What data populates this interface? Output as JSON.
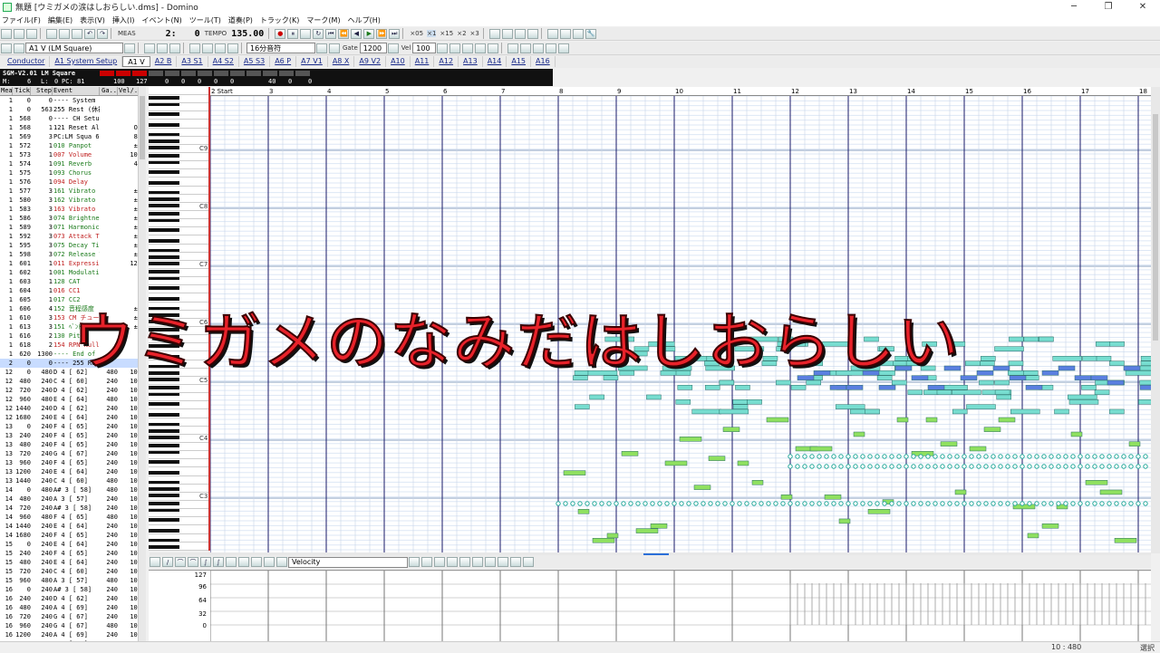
{
  "window": {
    "title": "無題 [ウミガメの涙はしおらしい.dms] - Domino"
  },
  "menu": [
    "ファイル(F)",
    "編集(E)",
    "表示(V)",
    "挿入(I)",
    "イベント(N)",
    "ツール(T)",
    "道奏(P)",
    "トラック(K)",
    "マーク(M)",
    "ヘルプ(H)"
  ],
  "toolbar": {
    "meas_label": "MEAS",
    "meas_value": "2:",
    "tick_value": "0",
    "tempo_label": "TEMPO",
    "tempo_value": "135.00",
    "speeds": [
      "×05",
      "×1",
      "×15",
      "×2",
      "×3"
    ]
  },
  "toolbar2": {
    "track_select": "A1 V (LM Square)",
    "note_length": "16分音符",
    "gate_label": "Gate",
    "gate_value": "1200",
    "vel_label": "Vel",
    "vel_value": "100"
  },
  "tabs": [
    "Conductor",
    "A1 System Setup",
    "A1 V",
    "A2 B",
    "A3 S1",
    "A4 S2",
    "A5 S3",
    "A6 P",
    "A7 V1",
    "A8 X",
    "A9 V2",
    "A10",
    "A11",
    "A12",
    "A13",
    "A14",
    "A15",
    "A16"
  ],
  "active_tab": "A1 V",
  "info": {
    "device": "SGM-V2.01 LM Square",
    "ch": "6",
    "l": "0",
    "pc": "81",
    "vals": [
      "100",
      "127",
      "0",
      "0",
      "0",
      "0",
      "0",
      "40",
      "0",
      "0"
    ]
  },
  "list": {
    "headers": [
      "Mea",
      "Tick",
      "Step",
      "Event",
      "Ga..",
      "Vel/.."
    ],
    "rows": [
      [
        "1",
        "0",
        "0",
        "---- System Setup ---",
        "",
        " "
      ],
      [
        "1",
        "0",
        "563",
        "255 Rest (休符)",
        "",
        ""
      ],
      [
        "1",
        "568",
        "0",
        "---- CH Setup ----",
        "",
        ""
      ],
      [
        "1",
        "568",
        "1",
        "121 Reset All C",
        "",
        "ON"
      ],
      [
        "1",
        "569",
        "3",
        "PC:LM Squa 6/0",
        "",
        "81"
      ],
      [
        "1",
        "572",
        "1",
        "010 Panpot",
        "",
        "±0"
      ],
      [
        "1",
        "573",
        "1",
        "007 Volume",
        "",
        "100"
      ],
      [
        "1",
        "574",
        "1",
        "091 Reverb",
        "",
        "40"
      ],
      [
        "1",
        "575",
        "1",
        "093 Chorus",
        "",
        "0"
      ],
      [
        "1",
        "576",
        "1",
        "094 Delay",
        "",
        "0"
      ],
      [
        "1",
        "577",
        "3",
        "161 Vibrato Rat",
        "",
        "±0"
      ],
      [
        "1",
        "580",
        "3",
        "162 Vibrato Dep",
        "",
        "±0"
      ],
      [
        "1",
        "583",
        "3",
        "163 Vibrato Del",
        "",
        "±0"
      ],
      [
        "1",
        "586",
        "3",
        "074 Brightness",
        "",
        "±0"
      ],
      [
        "1",
        "589",
        "3",
        "071 Harmonic Co",
        "",
        "±0"
      ],
      [
        "1",
        "592",
        "3",
        "073 Attack Time",
        "",
        "±0"
      ],
      [
        "1",
        "595",
        "3",
        "075 Decay Time",
        "",
        "±0"
      ],
      [
        "1",
        "598",
        "3",
        "072 Release Tin",
        "",
        "±0"
      ],
      [
        "1",
        "601",
        "1",
        "011 Expression",
        "",
        "127"
      ],
      [
        "1",
        "602",
        "1",
        "001 Modulation",
        "",
        "0"
      ],
      [
        "1",
        "603",
        "1",
        "128 CAT",
        "",
        "0"
      ],
      [
        "1",
        "604",
        "1",
        "016 CC1",
        "",
        "0"
      ],
      [
        "1",
        "605",
        "1",
        "017 CC2",
        "",
        "0"
      ],
      [
        "1",
        "606",
        "4",
        "152 音程感度",
        "",
        "±0"
      ],
      [
        "1",
        "610",
        "3",
        "153 CM チューン",
        "",
        "±0"
      ],
      [
        "1",
        "613",
        "3",
        "151 ﾍﾞﾝﾄﾞ幅",
        "",
        "±0"
      ],
      [
        "1",
        "616",
        "2",
        "130 Pitch",
        "",
        "0"
      ],
      [
        "1",
        "618",
        "2",
        "154 RPN Null",
        "",
        "0"
      ],
      [
        "1",
        "620",
        "1300",
        "---- End of CH Setup",
        "",
        ""
      ],
      [
        "2",
        "0",
        "0",
        "---- 255 Rest (休符)",
        "",
        ""
      ],
      [
        "12",
        "0",
        "480",
        "D  4 [ 62]",
        "480",
        "100"
      ],
      [
        "12",
        "480",
        "240",
        "C  4 [ 60]",
        "240",
        "100"
      ],
      [
        "12",
        "720",
        "240",
        "D  4 [ 62]",
        "240",
        "100"
      ],
      [
        "12",
        "960",
        "480",
        "E  4 [ 64]",
        "480",
        "100"
      ],
      [
        "12",
        "1440",
        "240",
        "D  4 [ 62]",
        "240",
        "100"
      ],
      [
        "12",
        "1680",
        "240",
        "E  4 [ 64]",
        "240",
        "100"
      ],
      [
        "13",
        "0",
        "240",
        "F  4 [ 65]",
        "240",
        "100"
      ],
      [
        "13",
        "240",
        "240",
        "F  4 [ 65]",
        "240",
        "100"
      ],
      [
        "13",
        "480",
        "240",
        "F  4 [ 65]",
        "240",
        "100"
      ],
      [
        "13",
        "720",
        "240",
        "G  4 [ 67]",
        "240",
        "100"
      ],
      [
        "13",
        "960",
        "240",
        "F  4 [ 65]",
        "240",
        "100"
      ],
      [
        "13",
        "1200",
        "240",
        "E  4 [ 64]",
        "240",
        "100"
      ],
      [
        "13",
        "1440",
        "240",
        "C  4 [ 60]",
        "480",
        "100"
      ],
      [
        "14",
        "0",
        "480",
        "A# 3 [ 58]",
        "480",
        "100"
      ],
      [
        "14",
        "480",
        "240",
        "A  3 [ 57]",
        "240",
        "100"
      ],
      [
        "14",
        "720",
        "240",
        "A# 3 [ 58]",
        "240",
        "100"
      ],
      [
        "14",
        "960",
        "480",
        "F  4 [ 65]",
        "480",
        "100"
      ],
      [
        "14",
        "1440",
        "240",
        "E  4 [ 64]",
        "240",
        "100"
      ],
      [
        "14",
        "1680",
        "240",
        "F  4 [ 65]",
        "240",
        "100"
      ],
      [
        "15",
        "0",
        "240",
        "E  4 [ 64]",
        "240",
        "100"
      ],
      [
        "15",
        "240",
        "240",
        "F  4 [ 65]",
        "240",
        "100"
      ],
      [
        "15",
        "480",
        "240",
        "E  4 [ 64]",
        "240",
        "100"
      ],
      [
        "15",
        "720",
        "240",
        "C  4 [ 60]",
        "240",
        "100"
      ],
      [
        "15",
        "960",
        "480",
        "A  3 [ 57]",
        "480",
        "100"
      ],
      [
        "16",
        "0",
        "240",
        "A# 3 [ 58]",
        "240",
        "100"
      ],
      [
        "16",
        "240",
        "240",
        "D  4 [ 62]",
        "240",
        "100"
      ],
      [
        "16",
        "480",
        "240",
        "A  4 [ 69]",
        "240",
        "100"
      ],
      [
        "16",
        "720",
        "240",
        "G  4 [ 67]",
        "240",
        "100"
      ],
      [
        "16",
        "960",
        "240",
        "G  4 [ 67]",
        "480",
        "100"
      ],
      [
        "16",
        "1200",
        "240",
        "A  4 [ 69]",
        "240",
        "100"
      ],
      [
        "16",
        "1440",
        "240",
        "G  4 [ 67]",
        "240",
        "100"
      ]
    ]
  },
  "ruler": [
    "2 Start",
    "3",
    "4",
    "5",
    "6",
    "7",
    "8",
    "9",
    "10",
    "11",
    "12",
    "13",
    "14",
    "15",
    "16",
    "17",
    "18"
  ],
  "octaves": [
    "C9",
    "C8",
    "C7",
    "C6",
    "C5",
    "C4",
    "C3",
    "C2"
  ],
  "overlay_text": "ウミガメのなみだはしおらしい",
  "velocity": {
    "select": "Velocity",
    "ticks": [
      "127",
      "96",
      "64",
      "32",
      "0"
    ]
  },
  "status": {
    "position": "10 : 480",
    "mode": "選択"
  },
  "colors": {
    "note_cyan": "#77ddd0",
    "note_green": "#8fe060",
    "note_blue": "#5a7fe0",
    "overlay_red": "#e8222a"
  }
}
